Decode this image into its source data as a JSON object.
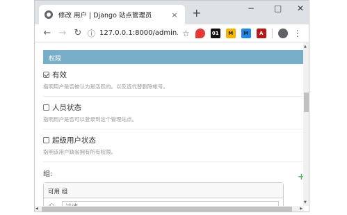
{
  "tab": {
    "title": "修改 用户 | Django 站点管理员",
    "close": "×"
  },
  "newtab": "+",
  "window": {
    "minimize": "−",
    "maximize": "□",
    "close": "✕"
  },
  "toolbar": {
    "back": "←",
    "forward": "→",
    "reload": "↻",
    "info": "ⓘ",
    "url": "127.0.0.1:8000/admin...",
    "star": "☆",
    "menu": "⋮"
  },
  "extensions": [
    {
      "name": "map-pin-extension-icon",
      "label": "",
      "color": "#e53935"
    },
    {
      "name": "extension-01-icon",
      "label": "01",
      "color": "#111111"
    },
    {
      "name": "extension-m-yellow-icon",
      "label": "M",
      "color": "#f4b400"
    },
    {
      "name": "extension-m-blue-icon",
      "label": "M",
      "color": "#1e88e5"
    },
    {
      "name": "pdf-extension-icon",
      "label": "A",
      "color": "#b71c1c"
    }
  ],
  "permissions": {
    "legend": "权限",
    "fields": [
      {
        "label": "有效",
        "help": "指明用户是否被认为是活跃的。以反选代替删除帐号。",
        "checked": true
      },
      {
        "label": "人员状态",
        "help": "指明用户是否可以登录到这个管理站点。",
        "checked": false
      },
      {
        "label": "超级用户状态",
        "help": "指明该用户缺省拥有所有权限。",
        "checked": false
      }
    ],
    "groups": {
      "label": "组:",
      "available": "可用 组",
      "filter_placeholder": "过滤",
      "add": "+"
    }
  }
}
